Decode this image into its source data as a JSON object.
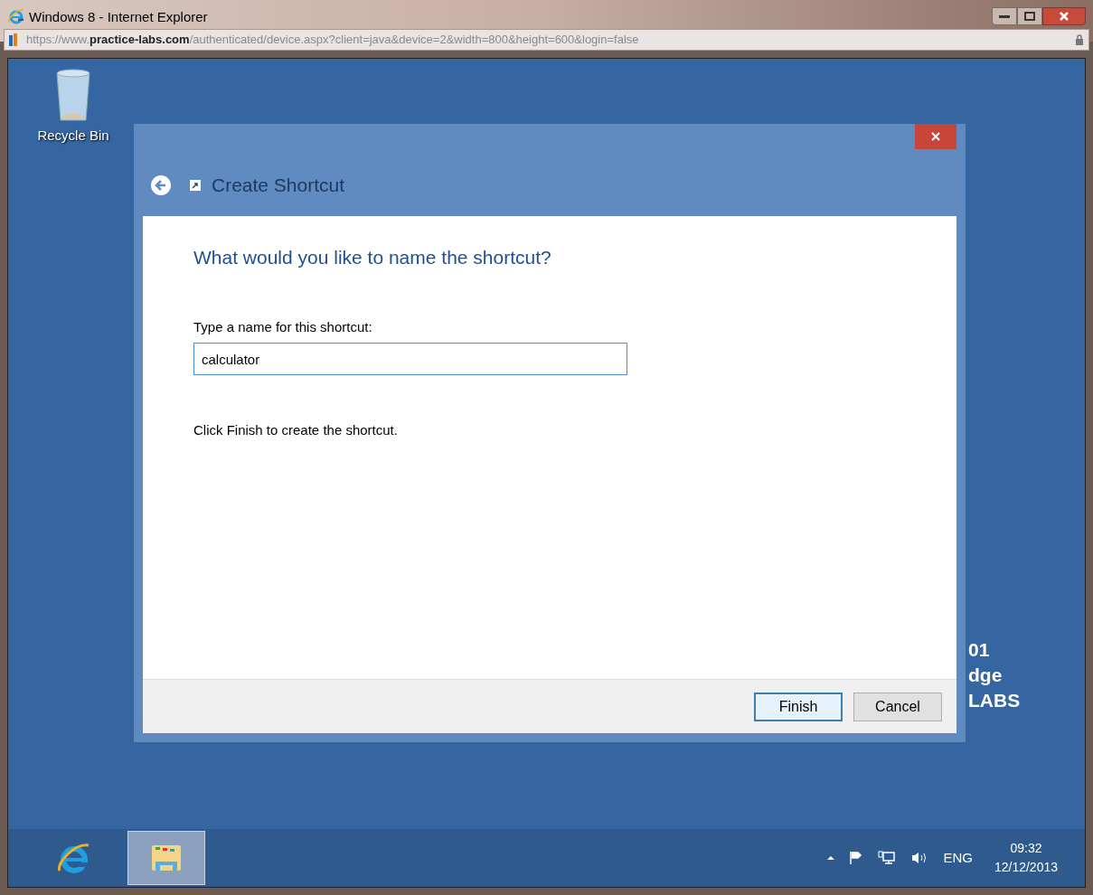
{
  "window": {
    "title": "Windows 8 - Internet Explorer"
  },
  "address_bar": {
    "url": "https://www.**practice-labs.com**/authenticated/device.aspx?client=java&device=2&width=800&height=600&login=false"
  },
  "desktop": {
    "icons": [
      {
        "label": "Recycle Bin"
      }
    ],
    "background_text": [
      "01",
      "dge",
      "LABS"
    ]
  },
  "dialog": {
    "title": "Create Shortcut",
    "heading": "What would you like to name the shortcut?",
    "field_label": "Type a name for this shortcut:",
    "field_value": "calculator",
    "instruction": "Click Finish to create the shortcut.",
    "buttons": [
      {
        "label": "Finish",
        "kind": "default"
      },
      {
        "label": "Cancel",
        "kind": "normal"
      }
    ]
  },
  "taskbar": {
    "items": [
      {
        "kind": "browser",
        "selected": false
      },
      {
        "kind": "folder",
        "selected": true
      }
    ],
    "tray": {
      "language": "ENG",
      "time": "09:32",
      "date": "12/12/2013"
    }
  }
}
